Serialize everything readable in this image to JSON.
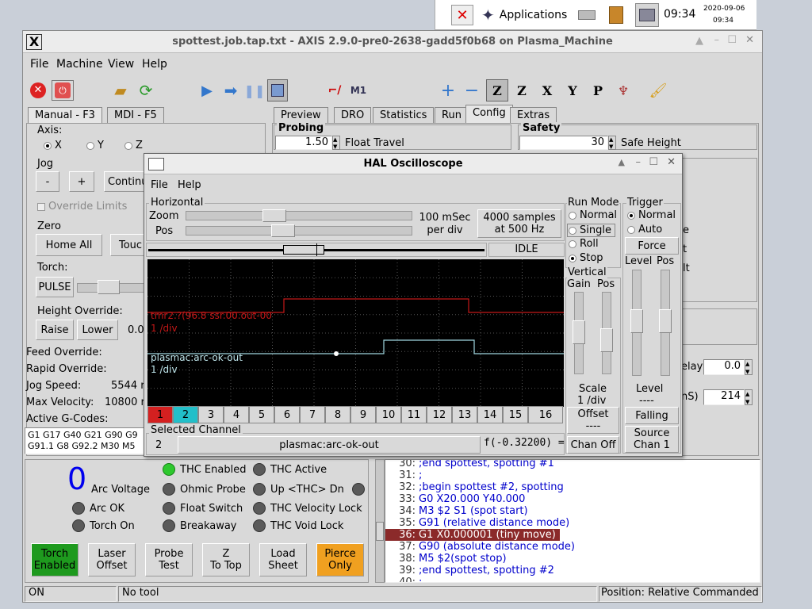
{
  "taskbar": {
    "applications_label": "Applications",
    "clock": "09:34",
    "date": "2020-09-06",
    "time_small": "09:34"
  },
  "axis": {
    "title": "spottest.job.tap.txt - AXIS 2.9.0-pre0-2638-gadd5f0b68 on Plasma_Machine",
    "menu": [
      "File",
      "Machine",
      "View",
      "Help"
    ],
    "left_tabs": [
      "Manual - F3",
      "MDI - F5"
    ],
    "right_tabs": [
      "Preview",
      "DRO",
      "Statistics",
      "Run",
      "Config",
      "Extras"
    ],
    "axis_label": "Axis:",
    "axes": [
      "X",
      "Y",
      "Z"
    ],
    "jog_label": "Jog",
    "jog_minus": "-",
    "jog_plus": "+",
    "jog_mode": "Continu",
    "override_limits": "Override Limits",
    "zero_label": "Zero",
    "home_all": "Home All",
    "touch": "Touc",
    "torch_label": "Torch:",
    "pulse": "PULSE",
    "height_override_label": "Height Override:",
    "raise": "Raise",
    "lower": "Lower",
    "height_value": "0.0",
    "feed_override": "Feed Override:",
    "rapid_override": "Rapid Override:",
    "jog_speed": "Jog Speed:",
    "jog_speed_val": "5544 r",
    "max_velocity": "Max Velocity:",
    "max_velocity_val": "10800 r",
    "active_gcodes_label": "Active G-Codes:",
    "gcodes_line1": "G1 G17 G40 G21 G90 G9",
    "gcodes_line2": "G91.1 G8 G92.2 M30 M5",
    "probing": {
      "title": "Probing",
      "value": "1.50",
      "label": "Float Travel"
    },
    "safety": {
      "title": "Safety",
      "value": "30",
      "label": "Safe Height"
    },
    "right_values": [
      {
        "label": "elay",
        "value": "0.0"
      },
      {
        "label": "nS)",
        "value": "214"
      }
    ],
    "hidden_right_labels": [
      "e",
      "t",
      "lt"
    ],
    "arc_voltage": {
      "value": "0",
      "label": "Arc Voltage"
    },
    "leds": [
      {
        "label": "THC Enabled",
        "on": true
      },
      {
        "label": "THC Active",
        "on": false
      },
      {
        "label": "Arc OK",
        "on": false
      },
      {
        "label": "Ohmic Probe",
        "on": false
      },
      {
        "label": "Up <THC> Dn",
        "on": false
      },
      {
        "label": "Torch On",
        "on": false
      },
      {
        "label": "Float Switch",
        "on": false
      },
      {
        "label": "THC Velocity Lock",
        "on": false
      },
      {
        "label": "Breakaway",
        "on": false
      },
      {
        "label": "THC Void Lock",
        "on": false
      }
    ],
    "bottom_buttons": [
      {
        "line1": "Torch",
        "line2": "Enabled",
        "color": "#1e9a1e"
      },
      {
        "line1": "Laser",
        "line2": "Offset",
        "color": "#d9d9d9"
      },
      {
        "line1": "Probe",
        "line2": "Test",
        "color": "#d9d9d9"
      },
      {
        "line1": "Z",
        "line2": "To Top",
        "color": "#d9d9d9"
      },
      {
        "line1": "Load",
        "line2": "Sheet",
        "color": "#d9d9d9"
      },
      {
        "line1": "Pierce",
        "line2": "Only",
        "color": "#f0a020"
      }
    ],
    "gcode_lines": [
      {
        "num": "30:",
        "text": ";end spottest, spotting #1"
      },
      {
        "num": "31:",
        "text": ";"
      },
      {
        "num": "32:",
        "text": ";begin spottest #2, spotting"
      },
      {
        "num": "33:",
        "text": "G0 X20.000 Y40.000"
      },
      {
        "num": "34:",
        "text": "M3 $2 S1 (spot start)"
      },
      {
        "num": "35:",
        "text": "G91 (relative distance mode)"
      },
      {
        "num": "36:",
        "text": "G1 X0.000001 (tiny move)"
      },
      {
        "num": "37:",
        "text": "G90 (absolute distance mode)"
      },
      {
        "num": "38:",
        "text": "M5 $2(spot stop)"
      },
      {
        "num": "39:",
        "text": ";end spottest, spotting #2"
      },
      {
        "num": "40:",
        "text": ";"
      }
    ],
    "highlighted_line": "36:",
    "status": {
      "state": "ON",
      "tool": "No tool",
      "position": "Position: Relative Commanded"
    }
  },
  "halscope": {
    "title": "HAL Oscilloscope",
    "menu": [
      "File",
      "Help"
    ],
    "horizontal_label": "Horizontal",
    "zoom_label": "Zoom",
    "pos_label": "Pos",
    "zoom_fraction": 0.38,
    "pos_fraction": 0.42,
    "rate_line1": "100 mSec",
    "rate_line2": "per div",
    "samples_line1": "4000 samples",
    "samples_line2": "at 500 Hz",
    "state": "IDLE",
    "run_mode_label": "Run Mode",
    "run_modes": [
      {
        "label": "Normal",
        "on": false
      },
      {
        "label": "Single",
        "on": false
      },
      {
        "label": "Roll",
        "on": false
      },
      {
        "label": "Stop",
        "on": true
      }
    ],
    "trigger_label": "Trigger",
    "trigger_modes": [
      {
        "label": "Normal",
        "on": true
      },
      {
        "label": "Auto",
        "on": false
      }
    ],
    "force": "Force",
    "level_label": "Level",
    "pos2_label": "Pos",
    "vertical_label": "Vertical",
    "gain_label": "Gain",
    "vpos_label": "Pos",
    "scale_label": "Scale",
    "scale_value": "1 /div",
    "offset_label": "Offset",
    "offset_value": "----",
    "chan_off": "Chan Off",
    "trig_level_label": "Level",
    "trig_level_value": "----",
    "falling": "Falling",
    "source_line1": "Source",
    "source_line2": "Chan  1",
    "ch1_label": "tmr2.?(96.8 ssr.00.out-00",
    "ch1_scale": "1 /div",
    "ch2_label": "plasmac:arc-ok-out",
    "ch2_scale": "1 /div",
    "channels": [
      "1",
      "2",
      "3",
      "4",
      "5",
      "6",
      "7",
      "8",
      "9",
      "10",
      "11",
      "12",
      "13",
      "14",
      "15",
      "16"
    ],
    "selected_channel_label": "Selected Channel",
    "selected_num": "2",
    "selected_name": "plasmac:arc-ok-out",
    "selected_value": "f(-0.32200) ="
  }
}
